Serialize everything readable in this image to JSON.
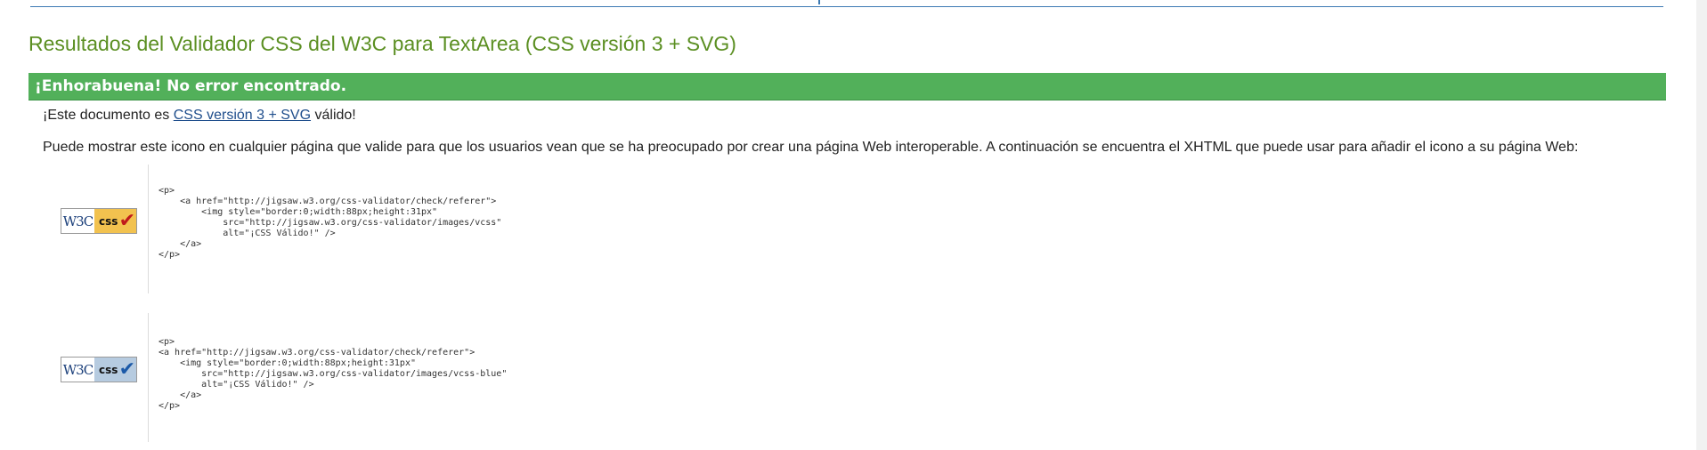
{
  "page": {
    "title": "Resultados del Validador CSS del W3C para TextArea (CSS versión 3 + SVG)"
  },
  "result": {
    "banner": "¡Enhorabuena! No error encontrado.",
    "valid_prefix": "¡Este documento es ",
    "valid_link": "CSS versión 3 + SVG",
    "valid_suffix": " válido!",
    "info": "Puede mostrar este icono en cualquier página que valide para que los usuarios vean que se ha preocupado por crear una página Web interoperable. A continuación se encuentra el XHTML que puede usar para añadir el icono a su página Web:"
  },
  "badges": [
    {
      "w3c_text": "W3C",
      "css_text": "css",
      "tick": "✔",
      "color": "#f2c24f",
      "code": "<p>\n    <a href=\"http://jigsaw.w3.org/css-validator/check/referer\">\n        <img style=\"border:0;width:88px;height:31px\"\n            src=\"http://jigsaw.w3.org/css-validator/images/vcss\"\n            alt=\"¡CSS Válido!\" />\n    </a>\n</p>"
    },
    {
      "w3c_text": "W3C",
      "css_text": "css",
      "tick": "✔",
      "color": "#b6cbe0",
      "code": "<p>\n<a href=\"http://jigsaw.w3.org/css-validator/check/referer\">\n    <img style=\"border:0;width:88px;height:31px\"\n        src=\"http://jigsaw.w3.org/css-validator/images/vcss-blue\"\n        alt=\"¡CSS Válido!\" />\n    </a>\n</p>"
    }
  ],
  "colors": {
    "title": "#5b8f22",
    "banner_bg": "#52b05a",
    "link": "#1f4e8c"
  }
}
